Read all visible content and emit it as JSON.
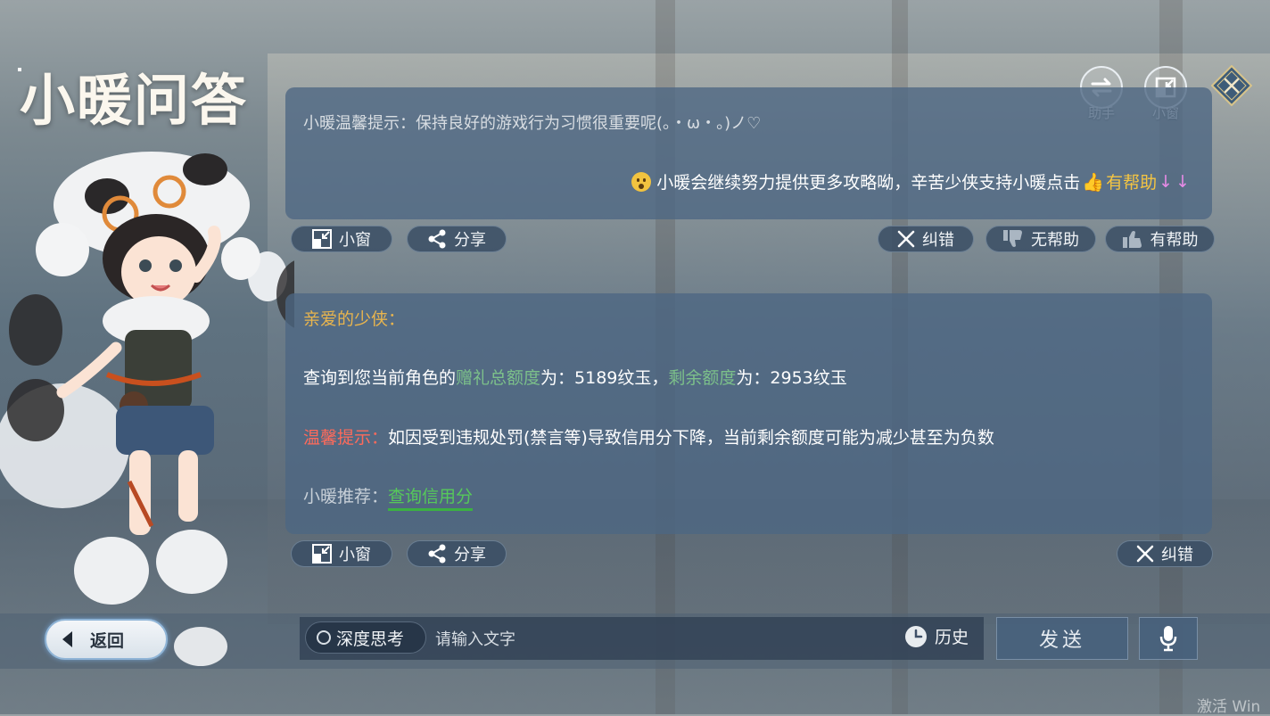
{
  "title": "小暖问答",
  "top_buttons": {
    "assistant_label": "助手",
    "small_window_label": "小窗"
  },
  "messages": [
    {
      "hint": "小暖温馨提示：保持良好的游戏行为习惯很重要呢(。・ω・。)ノ♡",
      "support_prefix": "小暖会继续努力提供更多攻略呦，辛苦少侠支持小暖点击",
      "support_highlight": "有帮助",
      "support_arrows": "↓↓",
      "actions": {
        "small_window": "小窗",
        "share": "分享",
        "correct": "纠错",
        "not_helpful": "无帮助",
        "helpful": "有帮助"
      }
    },
    {
      "greeting": "亲爱的少侠：",
      "line1": {
        "prefix": "查询到您当前角色的",
        "gift_label": "赠礼总额度",
        "gift_value": "为：5189纹玉，",
        "remain_label": "剩余额度",
        "remain_value": "为：2953纹玉"
      },
      "line2": {
        "label": "温馨提示：",
        "text": "如因受到违规处罚(禁言等)导致信用分下降，当前剩余额度可能为减少甚至为负数"
      },
      "line3": {
        "label": "小暖推荐：",
        "link": "查询信用分"
      },
      "actions": {
        "small_window": "小窗",
        "share": "分享",
        "correct": "纠错"
      }
    }
  ],
  "input_bar": {
    "deep_think": "深度思考",
    "placeholder": "请输入文字",
    "history": "历史",
    "send": "发送"
  },
  "back_button": "返回",
  "watermark": "激活 Win",
  "colors": {
    "card_bg": "#4d6783",
    "accent_yellow": "#f5c542",
    "accent_green": "#7cc08a",
    "link_green": "#56c95a",
    "warning_red": "#ff6a5b",
    "greeting_gold": "#e9b54e"
  }
}
